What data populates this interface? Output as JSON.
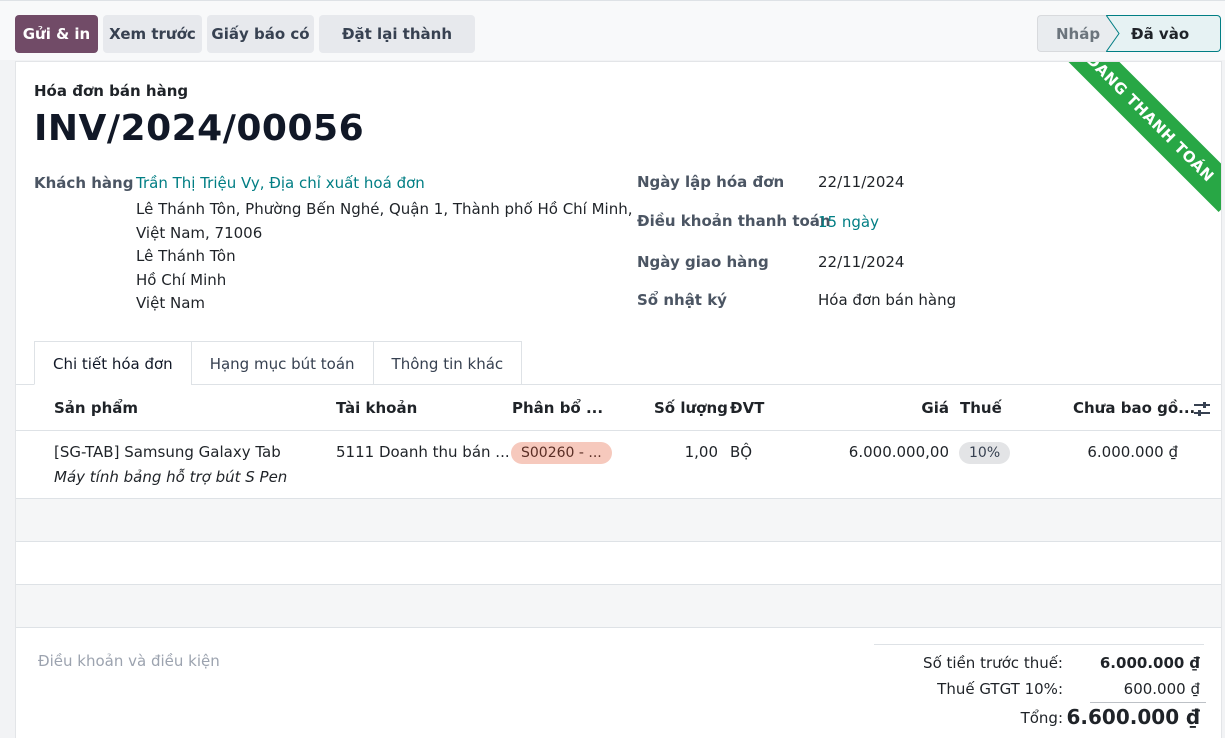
{
  "toolbar": {
    "send_print": "Gửi & in",
    "preview": "Xem trước",
    "credit_note": "Giấy báo có",
    "reset_draft": "Đặt lại thành nháp"
  },
  "statusbar": {
    "draft": "Nháp",
    "posted": "Đã vào sổ"
  },
  "ribbon": "ĐANG THANH TOÁN",
  "invoice": {
    "type": "Hóa đơn bán hàng",
    "name": "INV/2024/00056"
  },
  "customer": {
    "label": "Khách hàng",
    "name": "Trần Thị Triệu Vy, Địa chỉ xuất hoá đơn",
    "address": [
      "Lê Thánh Tôn, Phường Bến Nghé, Quận 1, Thành phố Hồ Chí Minh,",
      "Việt Nam, 71006",
      "Lê Thánh Tôn",
      "Hồ Chí Minh",
      "Việt Nam"
    ]
  },
  "fields": {
    "invoice_date_label": "Ngày lập hóa đơn",
    "invoice_date": "22/11/2024",
    "payment_terms_label": "Điều khoản thanh toán",
    "payment_terms": "15 ngày",
    "delivery_date_label": "Ngày giao hàng",
    "delivery_date": "22/11/2024",
    "journal_label": "Sổ nhật ký",
    "journal": "Hóa đơn bán hàng"
  },
  "tabs": [
    "Chi tiết hóa đơn",
    "Hạng mục bút toán",
    "Thông tin khác"
  ],
  "table": {
    "headers": {
      "product": "Sản phẩm",
      "account": "Tài khoản",
      "distribution": "Phân bổ ...",
      "quantity": "Số lượng",
      "uom": "ĐVT",
      "price": "Giá",
      "tax": "Thuế",
      "subtotal": "Chưa bao gồ..."
    },
    "rows": [
      {
        "product": "[SG-TAB] Samsung Galaxy Tab",
        "description": "Máy tính bảng hỗ trợ bút S Pen",
        "account": "5111 Doanh thu bán ...",
        "distribution": "S00260 - ...",
        "quantity": "1,00",
        "uom": "BỘ",
        "price": "6.000.000,00",
        "tax": "10%",
        "subtotal": "6.000.000 ₫"
      }
    ]
  },
  "terms_placeholder": "Điều khoản và điều kiện",
  "totals": {
    "untaxed_label": "Số tiền trước thuế:",
    "untaxed": "6.000.000 ₫",
    "vat_label": "Thuế GTGT 10%:",
    "vat": "600.000 ₫",
    "total_label": "Tổng:",
    "total": "6.600.000 ₫"
  },
  "colors": {
    "primary": "#714b67",
    "link": "#017e84",
    "ribbon": "#28a745"
  }
}
